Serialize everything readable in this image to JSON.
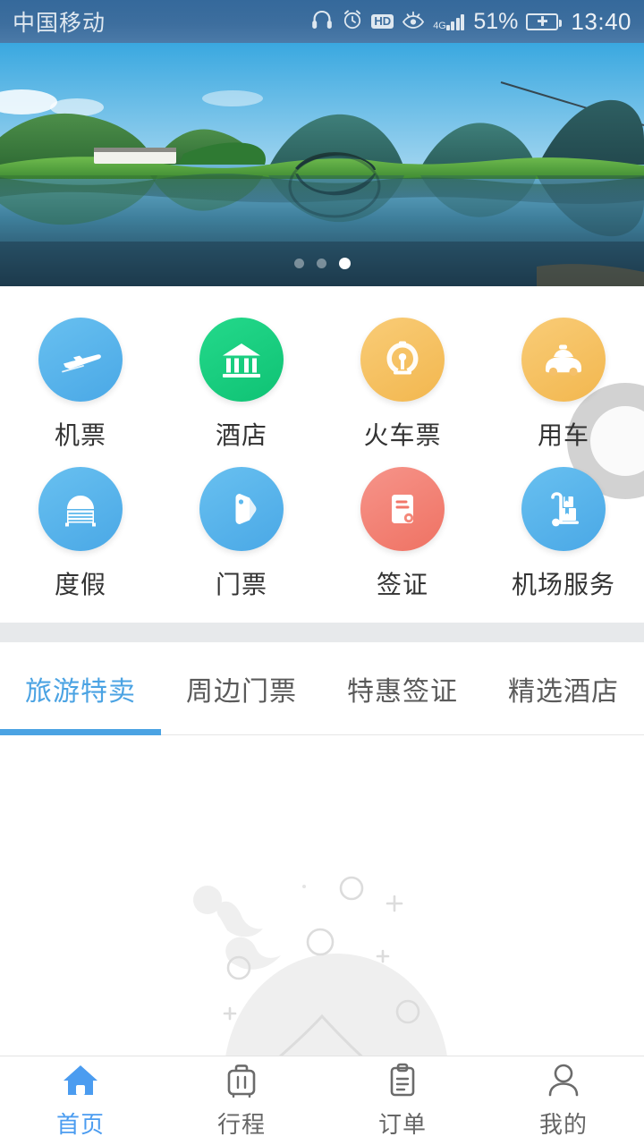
{
  "status_bar": {
    "carrier": "中国移动",
    "battery_percent": "51%",
    "time": "13:40",
    "hd_label": "HD",
    "network_label": "4G",
    "icons": [
      "headset-icon",
      "alarm-clock-icon",
      "hd-icon",
      "eye-care-icon",
      "signal-icon",
      "battery-charging-icon"
    ]
  },
  "banner": {
    "alt": "karst-mountain-lake-reflection-photo",
    "total_slides": 3,
    "active_slide": 3
  },
  "grid": {
    "items": [
      {
        "label": "机票",
        "icon": "airplane-icon",
        "color": "#5cb8ee",
        "color2": "#4fa9e8"
      },
      {
        "label": "酒店",
        "icon": "hotel-building-icon",
        "color": "#1ed182",
        "color2": "#0fc274"
      },
      {
        "label": "火车票",
        "icon": "train-railway-icon",
        "color": "#f7c365",
        "color2": "#f2b74f"
      },
      {
        "label": "用车",
        "icon": "taxi-car-icon",
        "color": "#f7c365",
        "color2": "#f2b74f"
      },
      {
        "label": "度假",
        "icon": "beach-umbrella-icon",
        "color": "#5cb8ee",
        "color2": "#4aa8e6"
      },
      {
        "label": "门票",
        "icon": "price-tag-icon",
        "color": "#5cb8ee",
        "color2": "#4aa8e6"
      },
      {
        "label": "签证",
        "icon": "visa-document-icon",
        "color": "#f4887a",
        "color2": "#ef7263"
      },
      {
        "label": "机场服务",
        "icon": "luggage-cart-icon",
        "color": "#5cb8ee",
        "color2": "#4aa8e6"
      }
    ]
  },
  "tabs": {
    "items": [
      {
        "label": "旅游特卖",
        "active": true
      },
      {
        "label": "周边门票",
        "active": false
      },
      {
        "label": "特惠签证",
        "active": false
      },
      {
        "label": "精选酒店",
        "active": false
      }
    ]
  },
  "content": {
    "empty_illustration": "empty-state-splash-illustration"
  },
  "bottom_nav": {
    "items": [
      {
        "label": "首页",
        "icon": "home-icon",
        "active": true
      },
      {
        "label": "行程",
        "icon": "suitcase-icon",
        "active": false
      },
      {
        "label": "订单",
        "icon": "clipboard-icon",
        "active": false
      },
      {
        "label": "我的",
        "icon": "person-icon",
        "active": false
      }
    ]
  },
  "colors": {
    "accent": "#4ba3e3",
    "nav_active": "#4b9cf0",
    "status_bar_bg": "#3d6e9e",
    "separator": "#e7e9eb"
  }
}
